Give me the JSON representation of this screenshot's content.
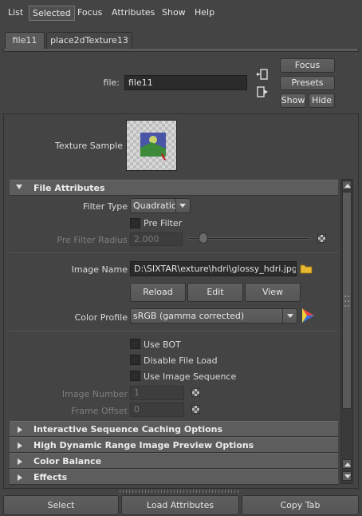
{
  "menu": [
    "List",
    "Selected",
    "Focus",
    "Attributes",
    "Show",
    "Help"
  ],
  "tabs": [
    "file11",
    "place2dTexture13"
  ],
  "node": {
    "file_label": "file:",
    "file_value": "file11",
    "focus": "Focus",
    "presets": "Presets",
    "show": "Show",
    "hide": "Hide"
  },
  "texture_sample_label": "Texture Sample",
  "file_attributes": {
    "header": "File Attributes",
    "filter_type_label": "Filter Type",
    "filter_type_value": "Quadratic",
    "pre_filter_label": "Pre Filter",
    "pre_filter_radius_label": "Pre Filter Radius",
    "pre_filter_radius_value": "2.000",
    "image_name_label": "Image Name",
    "image_name_value": "D:\\SIXTAR\\exture\\hdri\\glossy_hdri.jpg",
    "reload": "Reload",
    "edit": "Edit",
    "view": "View",
    "color_profile_label": "Color Profile",
    "color_profile_value": "sRGB (gamma corrected)",
    "use_bot": "Use BOT",
    "disable_file_load": "Disable File Load",
    "use_image_sequence": "Use Image Sequence",
    "image_number_label": "Image Number",
    "image_number_value": "1",
    "frame_offset_label": "Frame Offset",
    "frame_offset_value": "0"
  },
  "collapsed_sections": [
    "Interactive Sequence Caching Options",
    "High Dynamic Range Image Preview Options",
    "Color Balance",
    "Effects"
  ],
  "bottom": {
    "select": "Select",
    "load_attributes": "Load Attributes",
    "copy_tab": "Copy Tab"
  }
}
